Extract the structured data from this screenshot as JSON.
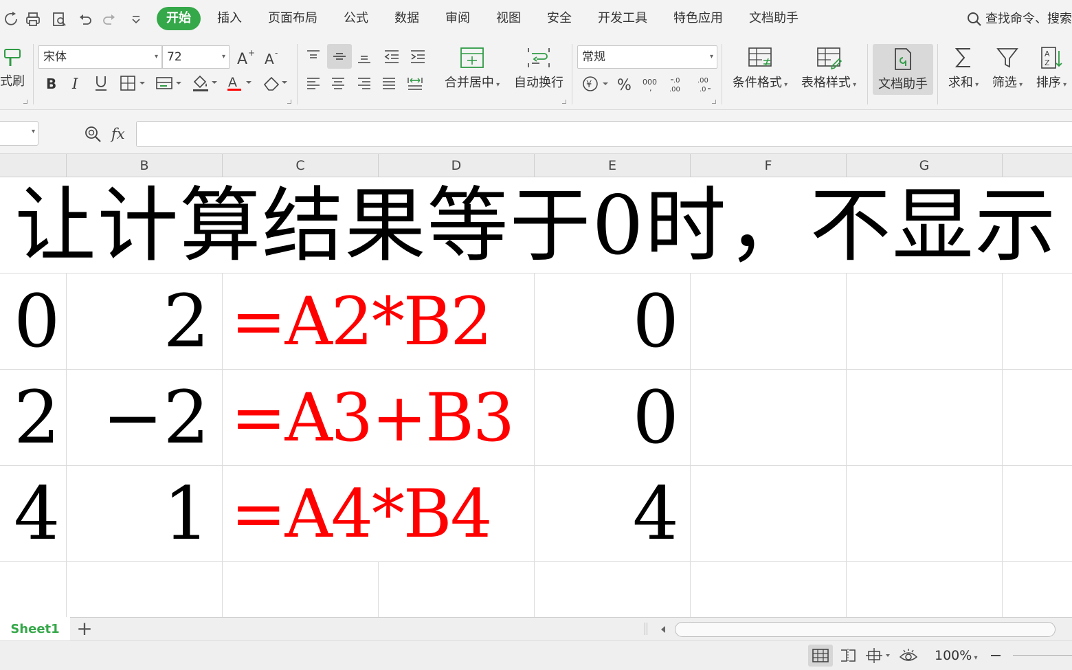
{
  "toolbar": {
    "tabs": [
      "开始",
      "插入",
      "页面布局",
      "公式",
      "数据",
      "审阅",
      "视图",
      "安全",
      "开发工具",
      "特色应用",
      "文档助手"
    ],
    "search_text": "查找命令、搜索"
  },
  "ribbon": {
    "format_painter": "式刷",
    "font_name": "宋体",
    "font_size": "72",
    "merge_center": "合并居中",
    "wrap_text": "自动换行",
    "number_format": "常规",
    "cond_format": "条件格式",
    "table_style": "表格样式",
    "doc_assistant": "文档助手",
    "sum": "求和",
    "filter": "筛选",
    "sort": "排序"
  },
  "formula_bar": {
    "fx": "fx",
    "content": ""
  },
  "grid": {
    "columns": [
      "B",
      "C",
      "D",
      "E",
      "F",
      "G"
    ],
    "title": "让计算结果等于0时，不显示",
    "rows": [
      {
        "a": "0",
        "b": "2",
        "formula": "=A2*B2",
        "result": "0"
      },
      {
        "a": "2",
        "b": "−2",
        "formula": "=A3+B3",
        "result": "0"
      },
      {
        "a": "4",
        "b": "1",
        "formula": "=A4*B4",
        "result": "4"
      }
    ]
  },
  "sheets": {
    "active": "Sheet1",
    "add": "+"
  },
  "statusbar": {
    "zoom": "100%"
  },
  "colors": {
    "accent": "#35a849",
    "formula_red": "#ff0000"
  }
}
